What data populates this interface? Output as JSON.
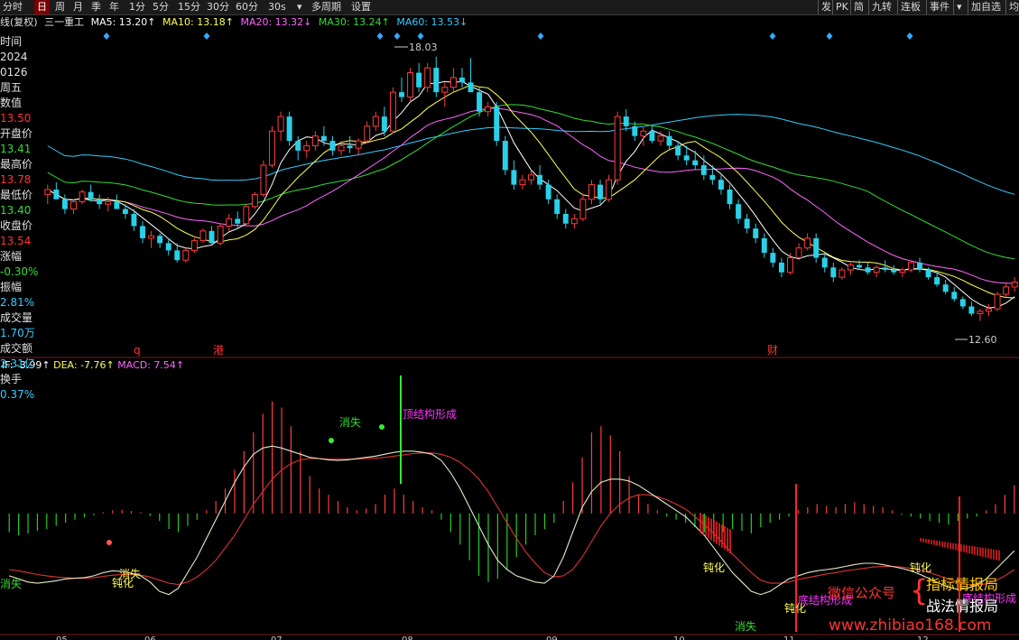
{
  "toolbar": {
    "items": [
      {
        "label": "分时",
        "selected": false
      },
      {
        "label": "日",
        "selected": true
      },
      {
        "label": "周",
        "selected": false
      },
      {
        "label": "月",
        "selected": false
      },
      {
        "label": "季",
        "selected": false
      },
      {
        "label": "年",
        "selected": false
      },
      {
        "label": "1分",
        "selected": false
      },
      {
        "label": "5分",
        "selected": false
      },
      {
        "label": "15分",
        "selected": false
      },
      {
        "label": "30分",
        "selected": false
      },
      {
        "label": "60分",
        "selected": false
      },
      {
        "label": "30s",
        "selected": false
      },
      {
        "label": "▾",
        "selected": false
      },
      {
        "label": "多周期",
        "selected": false
      },
      {
        "label": "设置",
        "selected": false
      }
    ],
    "right_items": [
      {
        "label": "发"
      },
      {
        "label": "PK"
      },
      {
        "label": "简"
      },
      {
        "label": "九转"
      },
      {
        "label": "连板"
      },
      {
        "label": "事件"
      },
      {
        "label": "▾"
      },
      {
        "label": "加自选"
      },
      {
        "label": "均"
      }
    ]
  },
  "chart_title": "线(复权)",
  "stock_name": "三一重工",
  "ma_legend": [
    {
      "label": "MA5: 13.20↑",
      "color": "#ffffff"
    },
    {
      "label": "MA10: 13.18↑",
      "color": "#ffff55"
    },
    {
      "label": "MA20: 13.32↓",
      "color": "#ff66ff"
    },
    {
      "label": "MA30: 13.24↑",
      "color": "#33dd33"
    },
    {
      "label": "MA60: 13.53↓",
      "color": "#33ccff"
    }
  ],
  "info_panel": [
    {
      "text": "时间",
      "color": "#e0e0e0"
    },
    {
      "text": "2024",
      "color": "#e0e0e0"
    },
    {
      "text": "0126",
      "color": "#e0e0e0"
    },
    {
      "text": "周五",
      "color": "#e0e0e0"
    },
    {
      "text": "数值",
      "color": "#e0e0e0"
    },
    {
      "text": "13.50",
      "color": "#ff3333"
    },
    {
      "text": "开盘价",
      "color": "#e0e0e0"
    },
    {
      "text": "13.41",
      "color": "#33dd33"
    },
    {
      "text": "最高价",
      "color": "#e0e0e0"
    },
    {
      "text": "13.78",
      "color": "#ff3333"
    },
    {
      "text": "最低价",
      "color": "#e0e0e0"
    },
    {
      "text": "13.40",
      "color": "#33dd33"
    },
    {
      "text": "收盘价",
      "color": "#e0e0e0"
    },
    {
      "text": "13.54",
      "color": "#ff3333"
    },
    {
      "text": "涨幅",
      "color": "#e0e0e0"
    },
    {
      "text": "-0.30%",
      "color": "#33dd33"
    },
    {
      "text": "振幅",
      "color": "#e0e0e0"
    },
    {
      "text": "2.81%",
      "color": "#33ccff"
    },
    {
      "text": "成交量",
      "color": "#e0e0e0"
    },
    {
      "text": "1.70万",
      "color": "#33ccff"
    },
    {
      "text": "成交额",
      "color": "#e0e0e0"
    },
    {
      "text": "2.31亿",
      "color": "#33ccff"
    },
    {
      "text": "换手",
      "color": "#e0e0e0"
    },
    {
      "text": "0.37%",
      "color": "#33ccff"
    }
  ],
  "price_markers": {
    "high": "18.03",
    "low": "12.60"
  },
  "event_labels": [
    {
      "text": "q",
      "color": "#ff3333"
    },
    {
      "text": "港",
      "color": "#ff3333"
    },
    {
      "text": "财",
      "color": "#ff3333"
    }
  ],
  "macd_legend": [
    {
      "label": "IF: -3.99↑",
      "color": "#ffffff"
    },
    {
      "label": "DEA: -7.76↑",
      "color": "#ffff55"
    },
    {
      "label": "MACD: 7.54↑",
      "color": "#ff66ff"
    }
  ],
  "macd_annotations": [
    {
      "text": "消失",
      "color": "#33dd33"
    },
    {
      "text": "顶结构形成",
      "color": "#ff33ff"
    },
    {
      "text": "消失",
      "color": "#ffff55"
    },
    {
      "text": "钝化",
      "color": "#ffff55"
    },
    {
      "text": "消失",
      "color": "#33dd33"
    },
    {
      "text": "钝化",
      "color": "#ffff55"
    },
    {
      "text": "钝化",
      "color": "#ffff55"
    },
    {
      "text": "底结构形成",
      "color": "#ff33ff"
    },
    {
      "text": "消失",
      "color": "#33dd33"
    },
    {
      "text": "钝化",
      "color": "#ffff55"
    },
    {
      "text": "底结构形成",
      "color": "#ff33ff"
    }
  ],
  "x_axis_labels": [
    "05",
    "06",
    "07",
    "08",
    "09",
    "10",
    "11",
    "12"
  ],
  "watermark": {
    "wechat": "微信公众号",
    "line1": "指标情报局",
    "line2": "战法情报局",
    "url": "www.zhibiao168.com"
  },
  "chart_data": {
    "type": "candlestick",
    "price_range": [
      12.0,
      18.6
    ],
    "macd_range": [
      -1.9,
      2.3
    ],
    "ma_colors": {
      "ma5": "#ffffff",
      "ma10": "#ffff55",
      "ma20": "#ff66ff",
      "ma30": "#33dd33",
      "ma60": "#33ccff"
    },
    "candles": [
      [
        15.2,
        15.4,
        15.0,
        15.3
      ],
      [
        15.3,
        15.45,
        15.15,
        15.1
      ],
      [
        15.1,
        15.2,
        14.8,
        14.9
      ],
      [
        14.9,
        15.1,
        14.8,
        15.05
      ],
      [
        15.05,
        15.3,
        15.0,
        15.25
      ],
      [
        15.25,
        15.4,
        15.05,
        15.1
      ],
      [
        15.1,
        15.2,
        14.9,
        15.0
      ],
      [
        15.0,
        15.15,
        14.85,
        15.05
      ],
      [
        15.05,
        15.2,
        14.95,
        14.9
      ],
      [
        14.9,
        15.0,
        14.7,
        14.8
      ],
      [
        14.8,
        14.9,
        14.45,
        14.55
      ],
      [
        14.55,
        14.65,
        14.2,
        14.3
      ],
      [
        14.3,
        14.45,
        14.1,
        14.35
      ],
      [
        14.35,
        14.4,
        14.1,
        14.2
      ],
      [
        14.2,
        14.3,
        13.95,
        14.05
      ],
      [
        14.05,
        14.2,
        13.8,
        13.85
      ],
      [
        13.85,
        14.1,
        13.8,
        14.05
      ],
      [
        14.05,
        14.3,
        14.0,
        14.25
      ],
      [
        14.25,
        14.5,
        14.2,
        14.45
      ],
      [
        14.45,
        14.55,
        14.15,
        14.2
      ],
      [
        14.2,
        14.6,
        14.15,
        14.55
      ],
      [
        14.55,
        14.8,
        14.45,
        14.7
      ],
      [
        14.7,
        14.85,
        14.5,
        14.6
      ],
      [
        14.6,
        15.0,
        14.55,
        14.95
      ],
      [
        14.95,
        15.25,
        14.9,
        15.2
      ],
      [
        15.2,
        15.9,
        15.15,
        15.8
      ],
      [
        15.8,
        16.6,
        15.75,
        16.5
      ],
      [
        16.5,
        16.9,
        16.3,
        16.8
      ],
      [
        16.8,
        16.9,
        16.2,
        16.3
      ],
      [
        16.3,
        16.4,
        15.9,
        16.1
      ],
      [
        16.1,
        16.3,
        15.95,
        16.2
      ],
      [
        16.2,
        16.5,
        16.1,
        16.4
      ],
      [
        16.4,
        16.6,
        16.2,
        16.3
      ],
      [
        16.3,
        16.4,
        16.0,
        16.1
      ],
      [
        16.1,
        16.3,
        16.0,
        16.2
      ],
      [
        16.2,
        16.4,
        16.05,
        16.15
      ],
      [
        16.15,
        16.35,
        16.0,
        16.3
      ],
      [
        16.3,
        16.7,
        16.25,
        16.6
      ],
      [
        16.6,
        16.9,
        16.5,
        16.8
      ],
      [
        16.8,
        17.0,
        16.4,
        16.5
      ],
      [
        16.5,
        17.4,
        16.45,
        17.3
      ],
      [
        17.3,
        17.6,
        17.1,
        17.2
      ],
      [
        17.2,
        17.8,
        17.1,
        17.7
      ],
      [
        17.7,
        17.9,
        17.3,
        17.4
      ],
      [
        17.4,
        17.9,
        17.3,
        17.8
      ],
      [
        17.8,
        18.03,
        17.2,
        17.3
      ],
      [
        17.3,
        17.5,
        17.0,
        17.4
      ],
      [
        17.4,
        17.8,
        17.3,
        17.6
      ],
      [
        17.6,
        17.8,
        17.4,
        17.5
      ],
      [
        17.5,
        18.0,
        17.4,
        17.3
      ],
      [
        17.3,
        17.4,
        16.8,
        16.9
      ],
      [
        16.9,
        17.1,
        16.8,
        17.0
      ],
      [
        17.0,
        17.1,
        16.2,
        16.3
      ],
      [
        16.3,
        16.4,
        15.6,
        15.7
      ],
      [
        15.7,
        15.9,
        15.3,
        15.4
      ],
      [
        15.4,
        15.6,
        15.3,
        15.5
      ],
      [
        15.5,
        15.7,
        15.4,
        15.6
      ],
      [
        15.6,
        15.8,
        15.3,
        15.4
      ],
      [
        15.4,
        15.5,
        15.0,
        15.1
      ],
      [
        15.1,
        15.2,
        14.7,
        14.8
      ],
      [
        14.8,
        14.9,
        14.5,
        14.6
      ],
      [
        14.6,
        14.8,
        14.5,
        14.7
      ],
      [
        14.7,
        15.2,
        14.65,
        15.1
      ],
      [
        15.1,
        15.5,
        15.0,
        15.4
      ],
      [
        15.4,
        15.5,
        15.0,
        15.1
      ],
      [
        15.1,
        15.6,
        15.05,
        15.5
      ],
      [
        15.5,
        16.9,
        15.4,
        16.8
      ],
      [
        16.8,
        16.95,
        16.5,
        16.6
      ],
      [
        16.6,
        16.7,
        16.3,
        16.4
      ],
      [
        16.4,
        16.6,
        16.2,
        16.5
      ],
      [
        16.5,
        16.6,
        16.25,
        16.3
      ],
      [
        16.3,
        16.5,
        16.2,
        16.4
      ],
      [
        16.4,
        16.5,
        16.1,
        16.2
      ],
      [
        16.2,
        16.3,
        15.9,
        16.0
      ],
      [
        16.0,
        16.2,
        15.8,
        15.9
      ],
      [
        15.9,
        16.1,
        15.7,
        15.8
      ],
      [
        15.8,
        16.0,
        15.5,
        15.6
      ],
      [
        15.6,
        15.8,
        15.4,
        15.5
      ],
      [
        15.5,
        15.6,
        15.2,
        15.3
      ],
      [
        15.3,
        15.4,
        14.9,
        15.0
      ],
      [
        15.0,
        15.1,
        14.6,
        14.7
      ],
      [
        14.7,
        14.8,
        14.4,
        14.5
      ],
      [
        14.5,
        14.6,
        14.2,
        14.3
      ],
      [
        14.3,
        14.4,
        13.9,
        14.0
      ],
      [
        14.0,
        14.1,
        13.7,
        13.8
      ],
      [
        13.8,
        13.9,
        13.5,
        13.6
      ],
      [
        13.6,
        14.0,
        13.55,
        13.9
      ],
      [
        13.9,
        14.2,
        13.85,
        14.1
      ],
      [
        14.1,
        14.4,
        14.05,
        14.3
      ],
      [
        14.3,
        14.4,
        13.8,
        13.9
      ],
      [
        13.9,
        14.0,
        13.6,
        13.7
      ],
      [
        13.7,
        13.8,
        13.4,
        13.5
      ],
      [
        13.5,
        13.7,
        13.45,
        13.65
      ],
      [
        13.65,
        13.8,
        13.55,
        13.75
      ],
      [
        13.75,
        13.85,
        13.65,
        13.7
      ],
      [
        13.7,
        13.8,
        13.55,
        13.6
      ],
      [
        13.6,
        13.75,
        13.5,
        13.7
      ],
      [
        13.7,
        13.85,
        13.6,
        13.65
      ],
      [
        13.65,
        13.75,
        13.55,
        13.6
      ],
      [
        13.6,
        13.7,
        13.5,
        13.65
      ],
      [
        13.65,
        13.85,
        13.6,
        13.8
      ],
      [
        13.8,
        13.9,
        13.6,
        13.65
      ],
      [
        13.65,
        13.7,
        13.45,
        13.5
      ],
      [
        13.5,
        13.6,
        13.3,
        13.35
      ],
      [
        13.35,
        13.45,
        13.15,
        13.2
      ],
      [
        13.2,
        13.3,
        13.0,
        13.05
      ],
      [
        13.05,
        13.1,
        12.85,
        12.9
      ],
      [
        12.9,
        13.0,
        12.7,
        12.75
      ],
      [
        12.75,
        12.85,
        12.6,
        12.8
      ],
      [
        12.8,
        12.95,
        12.7,
        12.85
      ],
      [
        12.85,
        13.2,
        12.8,
        13.15
      ],
      [
        13.15,
        13.4,
        13.1,
        13.3
      ],
      [
        13.3,
        13.5,
        13.2,
        13.4
      ]
    ],
    "macd_hist": [
      -0.3,
      -0.35,
      -0.32,
      -0.28,
      -0.25,
      -0.2,
      -0.15,
      -0.1,
      -0.06,
      -0.03,
      0.02,
      0.05,
      0.06,
      0.04,
      0.02,
      -0.04,
      -0.12,
      -0.25,
      -0.3,
      -0.2,
      -0.1,
      0.05,
      0.2,
      0.4,
      0.7,
      1.0,
      1.3,
      1.6,
      1.8,
      1.7,
      1.4,
      1.0,
      0.6,
      0.4,
      0.3,
      0.2,
      0.1,
      0.05,
      0.08,
      0.15,
      0.3,
      0.4,
      0.3,
      0.2,
      0.1,
      0.05,
      -0.1,
      -0.3,
      -0.5,
      -0.75,
      -1.0,
      -1.1,
      -1.05,
      -0.9,
      -0.7,
      -0.5,
      -0.35,
      -0.25,
      -0.15,
      0.2,
      0.5,
      0.9,
      1.3,
      1.4,
      1.25,
      1.0,
      0.6,
      0.3,
      0.15,
      0.05,
      -0.05,
      -0.1,
      -0.15,
      -0.22,
      -0.3,
      -0.4,
      -0.3,
      -0.25,
      -0.28,
      -0.32,
      -0.22,
      -0.15,
      -0.1,
      -0.05,
      0.05,
      0.1,
      0.15,
      0.12,
      0.1,
      0.15,
      0.18,
      0.15,
      0.12,
      0.1,
      0.05,
      -0.02,
      -0.05,
      -0.08,
      -0.12,
      -0.15,
      -0.18,
      -0.12,
      -0.08,
      -0.05,
      0.05,
      0.15,
      0.3,
      0.45
    ],
    "dif": [
      -1.0,
      -1.05,
      -1.1,
      -1.12,
      -1.1,
      -1.08,
      -1.05,
      -1.04,
      -1.03,
      -1.0,
      -0.95,
      -0.92,
      -0.93,
      -0.96,
      -1.0,
      -1.1,
      -1.25,
      -1.3,
      -1.2,
      -0.95,
      -0.7,
      -0.4,
      -0.1,
      0.2,
      0.5,
      0.75,
      0.95,
      1.05,
      1.08,
      1.05,
      1.0,
      0.95,
      0.9,
      0.88,
      0.86,
      0.85,
      0.86,
      0.88,
      0.9,
      0.92,
      0.95,
      0.98,
      1.0,
      1.0,
      0.98,
      0.95,
      0.85,
      0.65,
      0.4,
      0.1,
      -0.2,
      -0.5,
      -0.75,
      -0.9,
      -1.0,
      -1.05,
      -1.1,
      -1.12,
      -1.0,
      -0.7,
      -0.3,
      0.1,
      0.35,
      0.5,
      0.55,
      0.55,
      0.52,
      0.45,
      0.35,
      0.25,
      0.15,
      0.05,
      -0.05,
      -0.2,
      -0.35,
      -0.55,
      -0.75,
      -0.95,
      -1.1,
      -1.25,
      -1.3,
      -1.25,
      -1.15,
      -1.05,
      -1.0,
      -0.95,
      -0.92,
      -0.9,
      -0.88,
      -0.85,
      -0.82,
      -0.8,
      -0.8,
      -0.82,
      -0.85,
      -0.88,
      -0.92,
      -0.98,
      -1.05,
      -1.12,
      -1.18,
      -1.22,
      -1.2,
      -1.15,
      -1.05,
      -0.9,
      -0.75,
      -0.6
    ],
    "dea": [
      -0.9,
      -0.92,
      -0.95,
      -0.98,
      -1.0,
      -1.02,
      -1.03,
      -1.04,
      -1.04,
      -1.03,
      -1.01,
      -0.99,
      -0.98,
      -0.98,
      -0.99,
      -1.02,
      -1.07,
      -1.12,
      -1.14,
      -1.1,
      -1.02,
      -0.9,
      -0.75,
      -0.55,
      -0.35,
      -0.1,
      0.15,
      0.35,
      0.55,
      0.7,
      0.8,
      0.86,
      0.88,
      0.88,
      0.87,
      0.87,
      0.87,
      0.87,
      0.88,
      0.89,
      0.9,
      0.92,
      0.94,
      0.96,
      0.97,
      0.97,
      0.95,
      0.9,
      0.82,
      0.7,
      0.55,
      0.35,
      0.1,
      -0.15,
      -0.4,
      -0.62,
      -0.8,
      -0.95,
      -1.02,
      -1.0,
      -0.9,
      -0.7,
      -0.45,
      -0.2,
      0.0,
      0.15,
      0.25,
      0.3,
      0.3,
      0.27,
      0.22,
      0.15,
      0.07,
      -0.05,
      -0.18,
      -0.32,
      -0.48,
      -0.65,
      -0.8,
      -0.95,
      -1.07,
      -1.12,
      -1.12,
      -1.1,
      -1.06,
      -1.03,
      -1.0,
      -0.97,
      -0.95,
      -0.92,
      -0.9,
      -0.88,
      -0.86,
      -0.85,
      -0.85,
      -0.86,
      -0.88,
      -0.91,
      -0.95,
      -1.0,
      -1.05,
      -1.1,
      -1.14,
      -1.15,
      -1.13,
      -1.08,
      -1.0,
      -0.9
    ]
  }
}
